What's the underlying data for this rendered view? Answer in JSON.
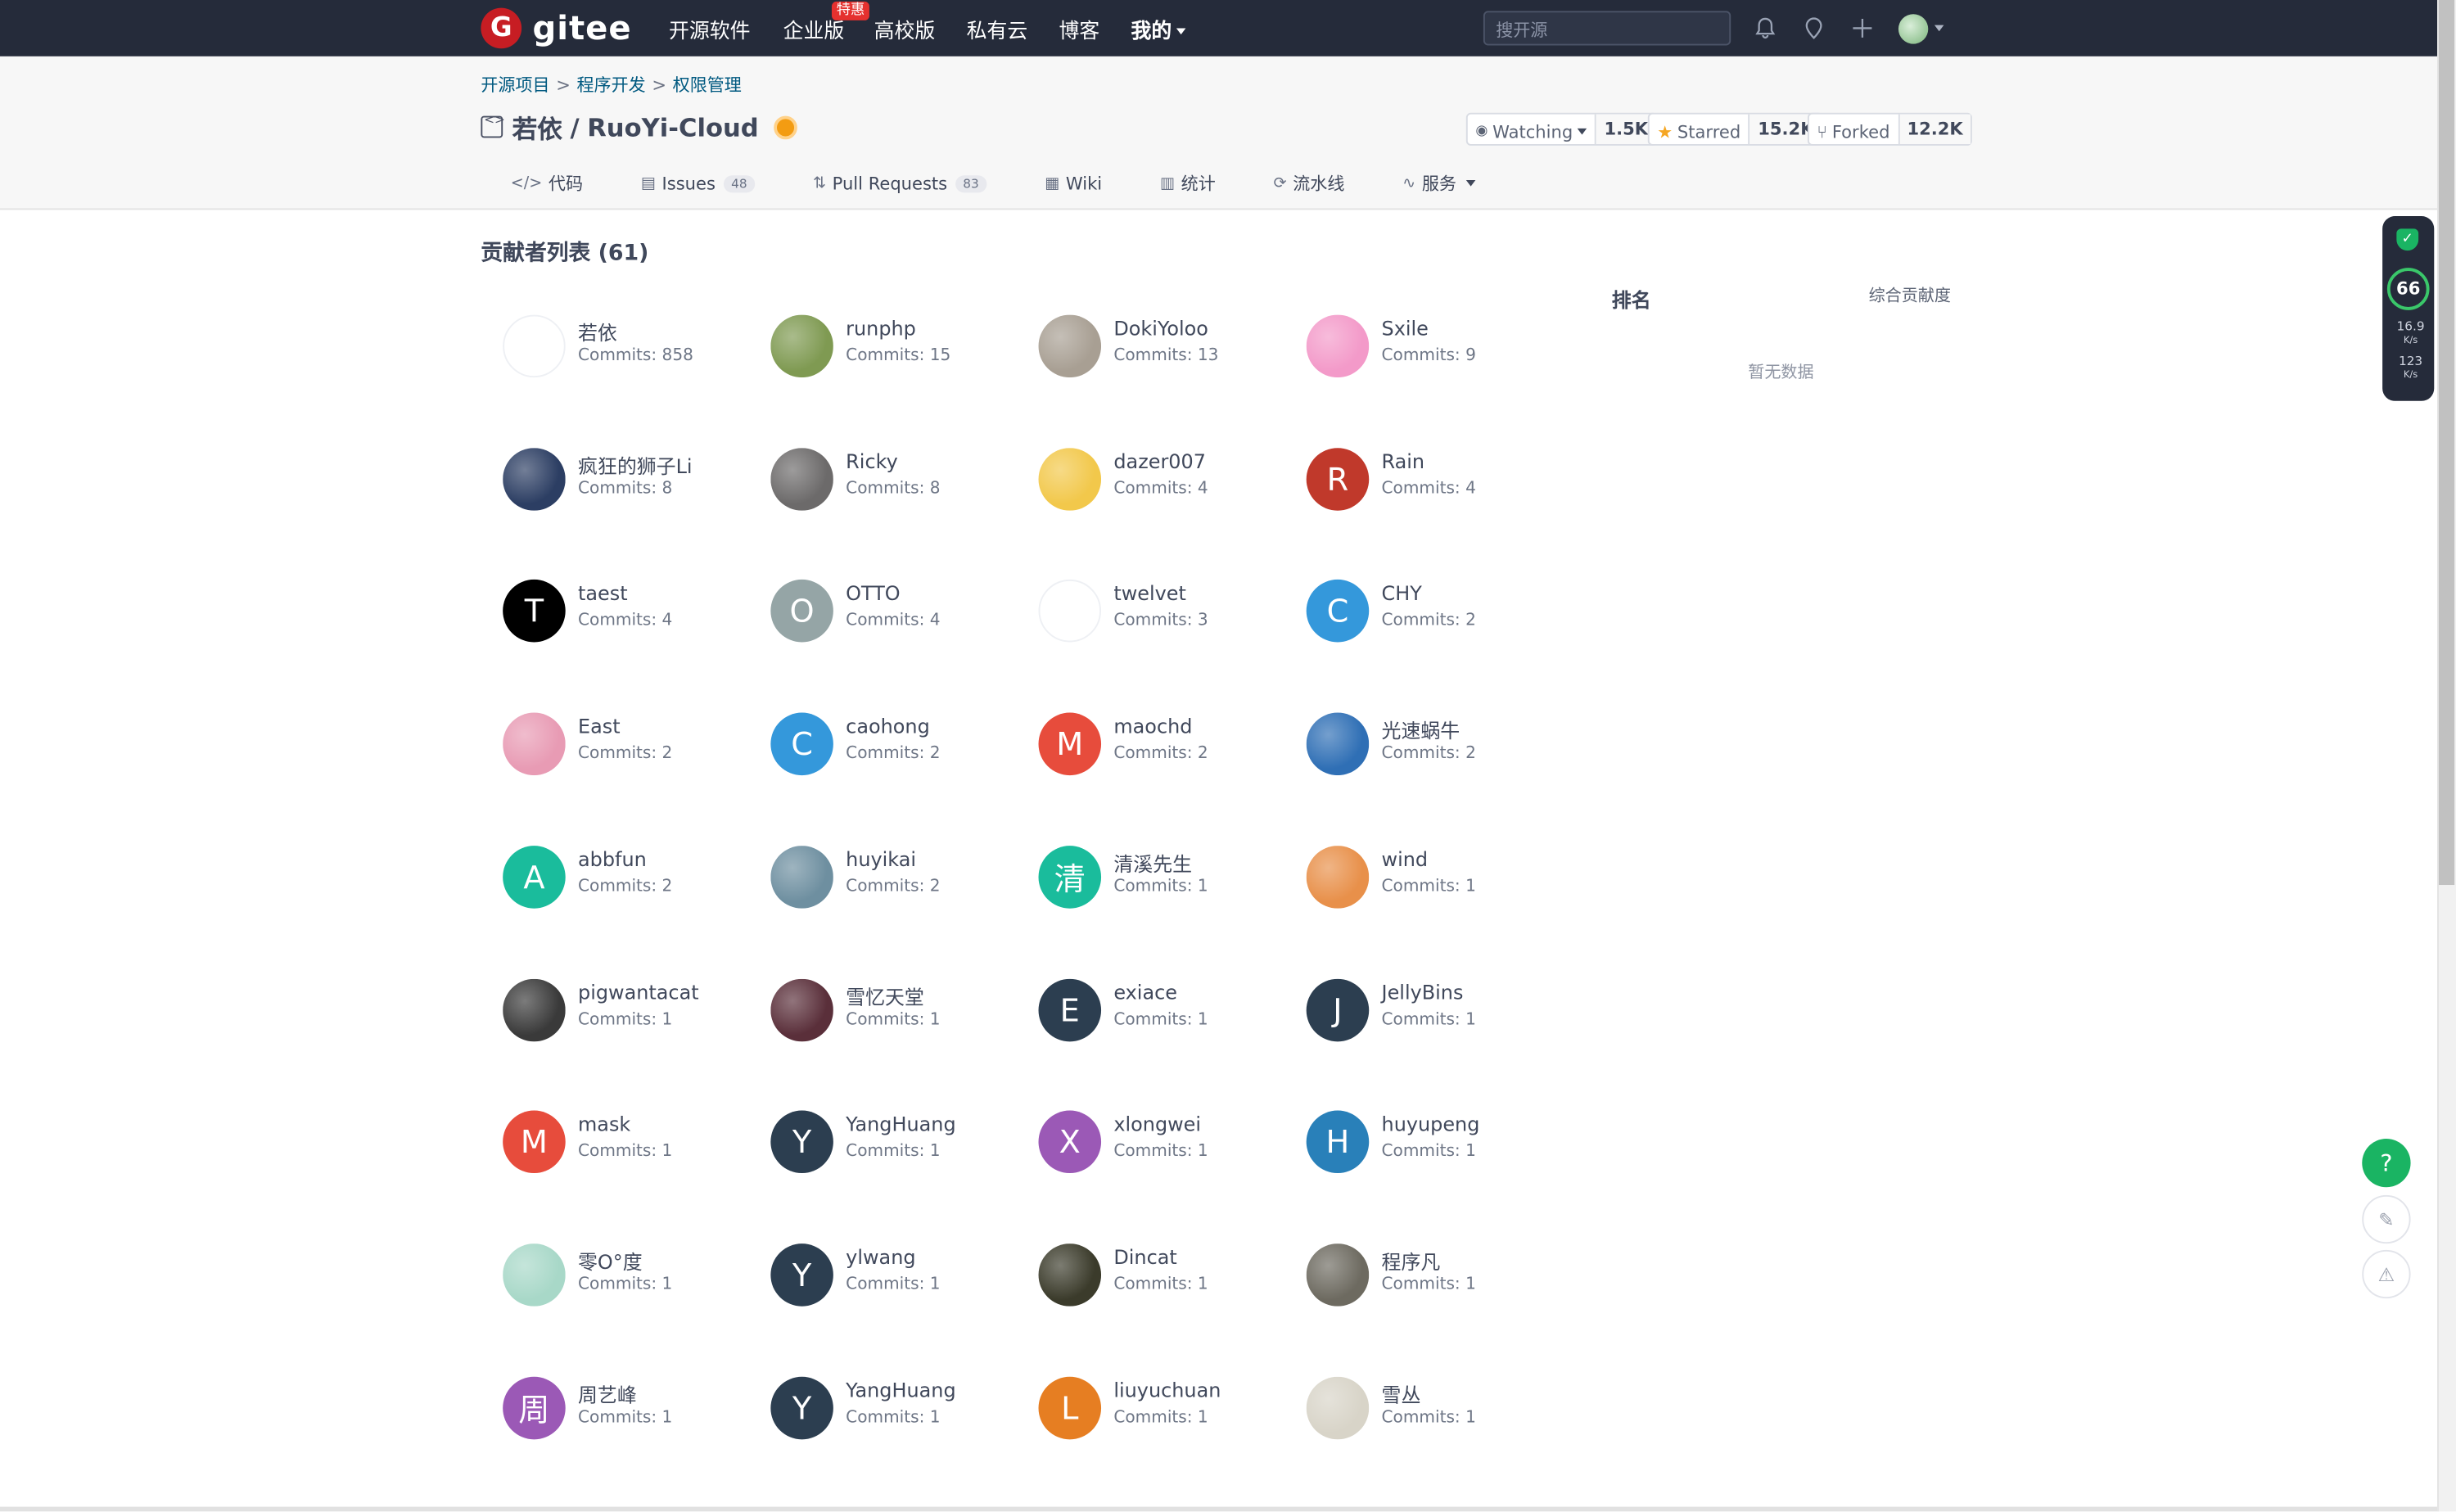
{
  "nav": {
    "logo_letter": "G",
    "logo_text": "gitee",
    "links": [
      "开源软件",
      "企业版",
      "高校版",
      "私有云",
      "博客",
      "我的"
    ],
    "hot_badge": "特惠",
    "search_placeholder": "搜开源"
  },
  "breadcrumb": [
    "开源项目",
    "程序开发",
    "权限管理"
  ],
  "breadcrumb_sep": ">",
  "repo": {
    "owner": "若依",
    "slash": "/",
    "name": "RuoYi-Cloud"
  },
  "stats": {
    "watch_label": "Watching",
    "watch_count": "1.5K",
    "star_label": "Starred",
    "star_count": "15.2K",
    "fork_label": "Forked",
    "fork_count": "12.2K"
  },
  "tabs": [
    {
      "icon": "</>",
      "label": "代码"
    },
    {
      "icon": "▤",
      "label": "Issues",
      "count": "48"
    },
    {
      "icon": "⇅",
      "label": "Pull Requests",
      "count": "83"
    },
    {
      "icon": "▦",
      "label": "Wiki"
    },
    {
      "icon": "▥",
      "label": "统计"
    },
    {
      "icon": "⟳",
      "label": "流水线"
    },
    {
      "icon": "∿",
      "label": "服务"
    }
  ],
  "contributors_title": "贡献者列表 (61)",
  "contributors": [
    {
      "name": "若依",
      "commits": "Commits: 858",
      "letter": "",
      "color": "#ffffff"
    },
    {
      "name": "runphp",
      "commits": "Commits: 15",
      "letter": "",
      "color": "#7f9a52"
    },
    {
      "name": "DokiYoloo",
      "commits": "Commits: 13",
      "letter": "",
      "color": "#a89f93"
    },
    {
      "name": "Sxile",
      "commits": "Commits: 9",
      "letter": "",
      "color": "#f39ac9"
    },
    {
      "name": "疯狂的狮子Li",
      "commits": "Commits: 8",
      "letter": "",
      "color": "#2c3e63"
    },
    {
      "name": "Ricky",
      "commits": "Commits: 8",
      "letter": "",
      "color": "#6c6a6a"
    },
    {
      "name": "dazer007",
      "commits": "Commits: 4",
      "letter": "",
      "color": "#f2c84b"
    },
    {
      "name": "Rain",
      "commits": "Commits: 4",
      "letter": "R",
      "color": "#c0392b"
    },
    {
      "name": "taest",
      "commits": "Commits: 4",
      "letter": "T",
      "color": "#000000"
    },
    {
      "name": "OTTO",
      "commits": "Commits: 4",
      "letter": "O",
      "color": "#95a5a6"
    },
    {
      "name": "twelvet",
      "commits": "Commits: 3",
      "letter": "",
      "color": "#ffffff"
    },
    {
      "name": "CHY",
      "commits": "Commits: 2",
      "letter": "C",
      "color": "#3498db"
    },
    {
      "name": "East",
      "commits": "Commits: 2",
      "letter": "",
      "color": "#e89bb4"
    },
    {
      "name": "caohong",
      "commits": "Commits: 2",
      "letter": "C",
      "color": "#3498db"
    },
    {
      "name": "maochd",
      "commits": "Commits: 2",
      "letter": "M",
      "color": "#e74c3c"
    },
    {
      "name": "光速蜗牛",
      "commits": "Commits: 2",
      "letter": "",
      "color": "#2f6fb5"
    },
    {
      "name": "abbfun",
      "commits": "Commits: 2",
      "letter": "A",
      "color": "#1abc9c"
    },
    {
      "name": "huyikai",
      "commits": "Commits: 2",
      "letter": "",
      "color": "#6e8fa0"
    },
    {
      "name": "清溪先生",
      "commits": "Commits: 1",
      "letter": "清",
      "color": "#1abc9c"
    },
    {
      "name": "wind",
      "commits": "Commits: 1",
      "letter": "",
      "color": "#e8904a"
    },
    {
      "name": "pigwantacat",
      "commits": "Commits: 1",
      "letter": "",
      "color": "#3a3a3a"
    },
    {
      "name": "雪忆天堂",
      "commits": "Commits: 1",
      "letter": "",
      "color": "#5a2f3a"
    },
    {
      "name": "exiace",
      "commits": "Commits: 1",
      "letter": "E",
      "color": "#2c3e50"
    },
    {
      "name": "JellyBins",
      "commits": "Commits: 1",
      "letter": "J",
      "color": "#2c3e50"
    },
    {
      "name": "mask",
      "commits": "Commits: 1",
      "letter": "M",
      "color": "#e74c3c"
    },
    {
      "name": "YangHuang",
      "commits": "Commits: 1",
      "letter": "Y",
      "color": "#2c3e50"
    },
    {
      "name": "xlongwei",
      "commits": "Commits: 1",
      "letter": "X",
      "color": "#9b59b6"
    },
    {
      "name": "huyupeng",
      "commits": "Commits: 1",
      "letter": "H",
      "color": "#2980b9"
    },
    {
      "name": "零O°度",
      "commits": "Commits: 1",
      "letter": "",
      "color": "#a8d8c8"
    },
    {
      "name": "ylwang",
      "commits": "Commits: 1",
      "letter": "Y",
      "color": "#2c3e50"
    },
    {
      "name": "Dincat",
      "commits": "Commits: 1",
      "letter": "",
      "color": "#3b3b2b"
    },
    {
      "name": "程序凡",
      "commits": "Commits: 1",
      "letter": "",
      "color": "#6d6a60"
    },
    {
      "name": "周艺峰",
      "commits": "Commits: 1",
      "letter": "周",
      "color": "#9b59b6"
    },
    {
      "name": "YangHuang",
      "commits": "Commits: 1",
      "letter": "Y",
      "color": "#2c3e50"
    },
    {
      "name": "liuyuchuan",
      "commits": "Commits: 1",
      "letter": "L",
      "color": "#e67e22"
    },
    {
      "name": "雪丛",
      "commits": "Commits: 1",
      "letter": "",
      "color": "#d8d4c8"
    }
  ],
  "ranking": {
    "title": "排名",
    "subtitle": "综合贡献度",
    "empty": "暂无数据"
  },
  "speed": {
    "score": "66",
    "down": "16.9",
    "down_unit": "K/s",
    "up": "123",
    "up_unit": "K/s"
  },
  "fab": {
    "help": "?"
  }
}
